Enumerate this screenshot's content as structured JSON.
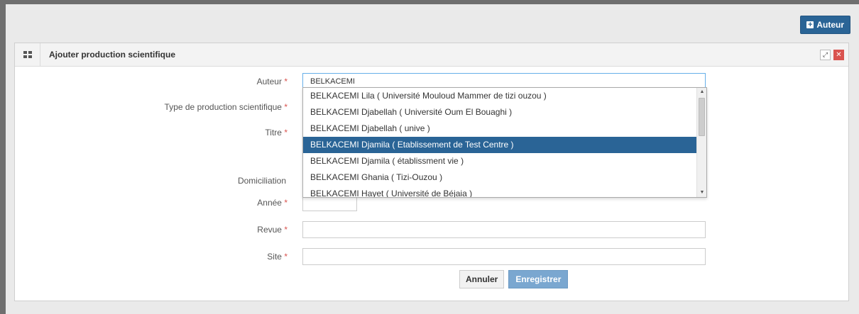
{
  "toolbar": {
    "add_author_label": "Auteur"
  },
  "widget": {
    "title": "Ajouter production scientifique"
  },
  "form": {
    "author_label": "Auteur",
    "author_value": "BELKACEMI",
    "type_label": "Type de production scientifique",
    "title_label": "Titre",
    "domiciliation_label": "Domiciliation",
    "year_label": "Année",
    "journal_label": "Revue",
    "site_label": "Site",
    "required_mark": "*"
  },
  "autocomplete": {
    "items": [
      "BELKACEMI Lila ( Université Mouloud Mammer de tizi ouzou )",
      "BELKACEMI Djabellah ( Université Oum El Bouaghi )",
      "BELKACEMI Djabellah ( unive )",
      "BELKACEMI Djamila ( Etablissement de Test Centre )",
      "BELKACEMI Djamila ( établissment vie )",
      "BELKACEMI Ghania ( Tizi-Ouzou )",
      "BELKACEMI Hayet ( Université de Béjaia )"
    ],
    "highlighted_index": 3
  },
  "actions": {
    "cancel_label": "Annuler",
    "save_label": "Enregistrer"
  },
  "colors": {
    "primary": "#2a6496",
    "danger": "#d9534f",
    "required": "#d9534f",
    "save_disabled": "#7aa7d0"
  },
  "icons": {
    "add_author": "plus-square-icon",
    "widget": "grid-icon",
    "expand": "expand-icon",
    "close": "close-icon"
  }
}
